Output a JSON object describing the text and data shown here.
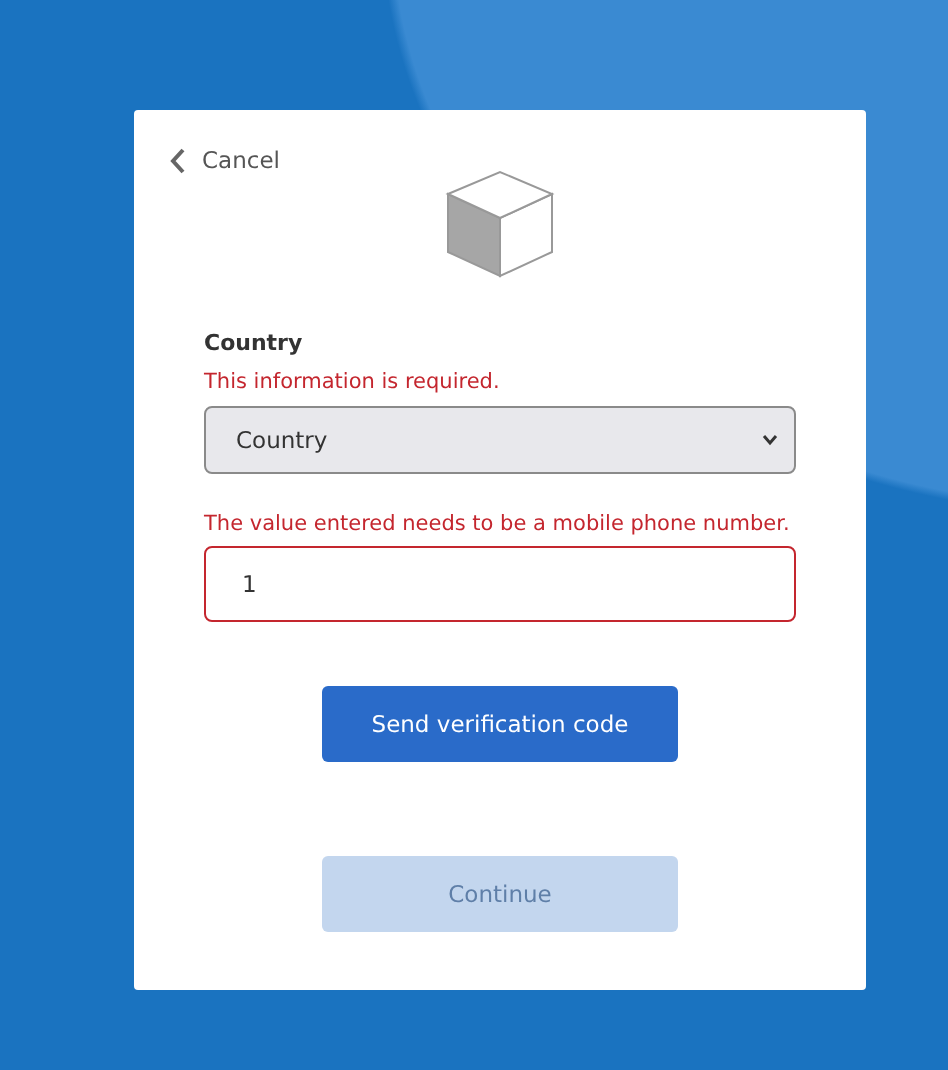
{
  "cancel": {
    "label": "Cancel"
  },
  "country": {
    "label": "Country",
    "error": "This information is required.",
    "value": "Country",
    "invalid": true
  },
  "phone": {
    "error": "The value entered needs to be a mobile phone number.",
    "value": "1",
    "invalid": true
  },
  "buttons": [
    {
      "label": "Send verification code",
      "disabled": false
    },
    {
      "label": "Continue",
      "disabled": true
    }
  ]
}
